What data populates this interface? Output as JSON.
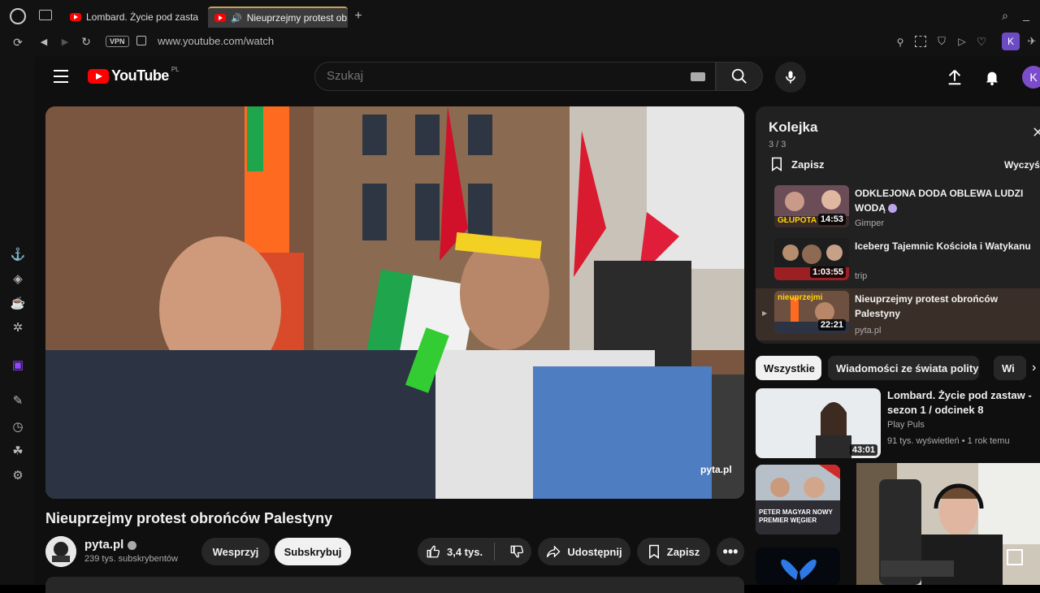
{
  "browser": {
    "tabs": [
      {
        "label": "Lombard. Życie pod zastaw"
      },
      {
        "label": "Nieuprzejmy protest obroń"
      }
    ],
    "vpn_label": "VPN",
    "url": "www.youtube.com/watch",
    "profile_letter": "K"
  },
  "youtube": {
    "logo_text": "YouTube",
    "country_code": "PL",
    "search_placeholder": "Szukaj",
    "account_letter": "K"
  },
  "video": {
    "title": "Nieuprzejmy protest obrońców Palestyny",
    "watermark": "pyta.pl",
    "channel": "pyta.pl",
    "subscribers": "239 tys. subskrybentów",
    "support_label": "Wesprzyj",
    "subscribe_label": "Subskrybuj",
    "likes": "3,4 tys.",
    "share_label": "Udostępnij",
    "save_label": "Zapisz"
  },
  "queue": {
    "title": "Kolejka",
    "count": "3 / 3",
    "save_label": "Zapisz",
    "clear_label": "Wyczyść",
    "items": [
      {
        "title": "ODKLEJONA DODA OBLEWA LUDZI WODĄ",
        "channel": "Gimper",
        "duration": "14:53",
        "thumb_text": "GŁUPOTA"
      },
      {
        "title": "Iceberg Tajemnic Kościoła i Watykanu",
        "channel": "trip",
        "duration": "1:03:55"
      },
      {
        "title": "Nieuprzejmy protest obrońców Palestyny",
        "channel": "pyta.pl",
        "duration": "22:21",
        "thumb_text": "nieuprzejmi"
      }
    ]
  },
  "chips": [
    "Wszystkie",
    "Wiadomości ze świata polityki",
    "Wi"
  ],
  "recommendations": [
    {
      "title": "Lombard. Życie pod zastaw - sezon 1 / odcinek 8",
      "channel": "Play Puls",
      "meta": "91 tys. wyświetleń • 1 rok temu",
      "duration": "43:01"
    },
    {
      "thumb_text": "PETER MAGYAR NOWY PREMIER WĘGIER"
    }
  ],
  "colors": {
    "accent": "#ff0000",
    "background": "#0f0f0f",
    "surface": "#212121"
  }
}
